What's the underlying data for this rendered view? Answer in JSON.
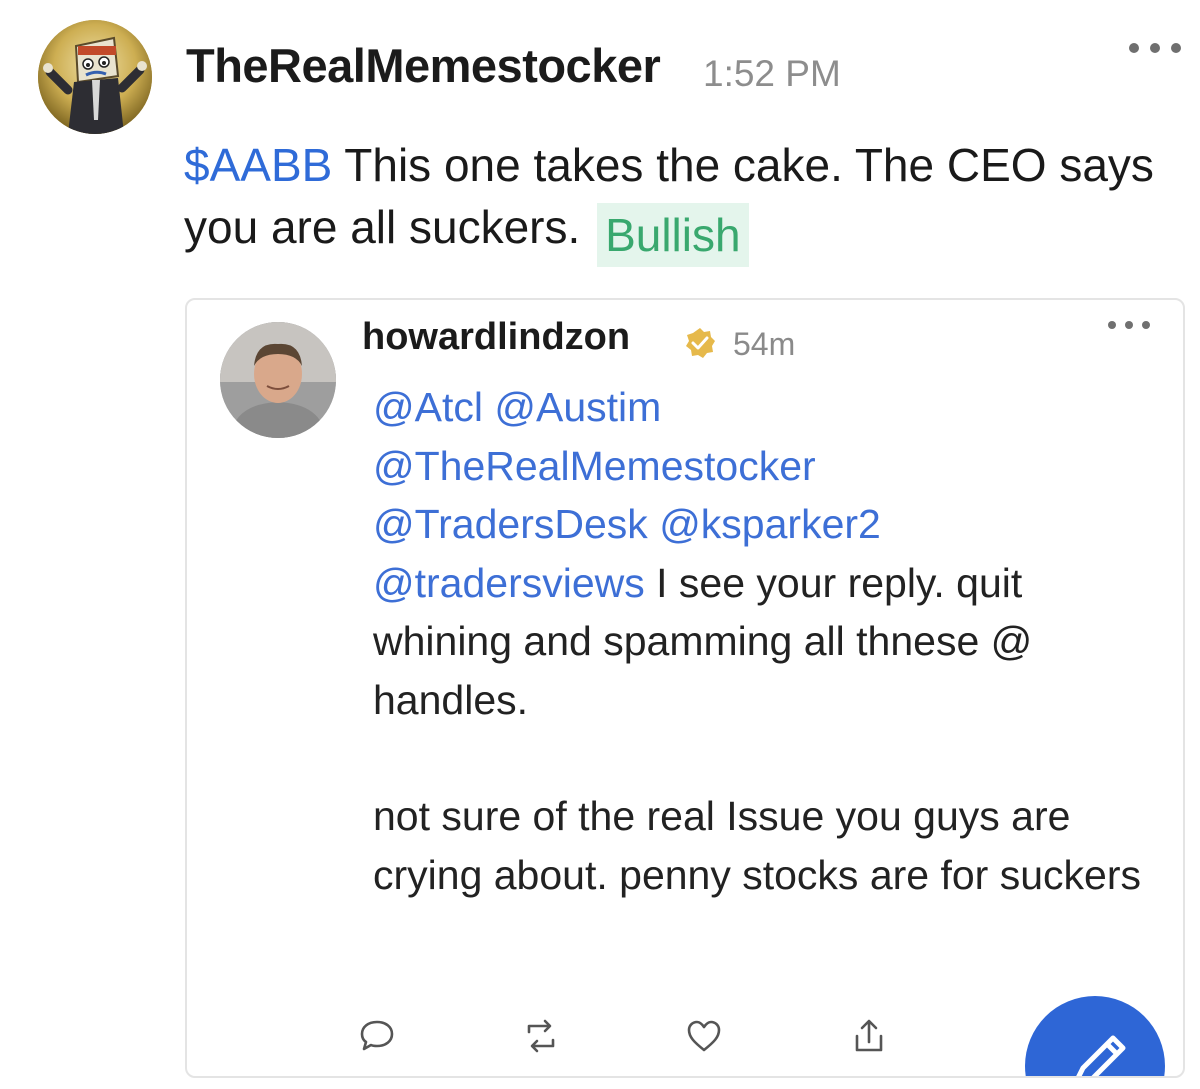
{
  "post": {
    "username": "TheRealMemestocker",
    "timestamp": "1:52 PM",
    "cashtag": "$AABB",
    "text": " This one takes the cake. The CEO says you are all suckers.",
    "sentiment": "Bullish"
  },
  "embed": {
    "username": "howardlindzon",
    "time": "54m",
    "mentions": [
      "@Atcl",
      "@Austim",
      "@TheRealMemestocker",
      "@TradersDesk",
      "@ksparker2",
      "@tradersviews"
    ],
    "text_line1": " I see your reply.  quit whining and spamming all thnese @ handles.",
    "text_line2": "not sure of the real Issue you guys are crying about.  penny stocks are for suckers"
  },
  "icons": {
    "more_main": "more-horizontal-icon",
    "verified": "verified-badge-icon",
    "reply": "comment-icon",
    "reshare": "reshare-icon",
    "like": "heart-icon",
    "share": "share-icon",
    "compose": "compose-icon"
  },
  "colors": {
    "cashtag": "#2f6bd8",
    "sentiment_text": "#39a86e",
    "sentiment_bg": "#e4f5ec",
    "mention": "#3d6fd6",
    "fab": "#2e66d6",
    "verified": "#e6b94b"
  }
}
